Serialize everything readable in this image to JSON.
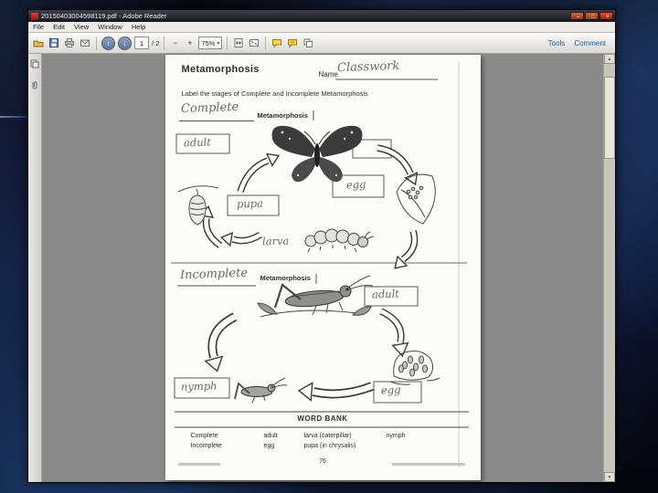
{
  "window": {
    "title": "20150403004598119.pdf - Adobe Reader",
    "menus": [
      "File",
      "Edit",
      "View",
      "Window",
      "Help"
    ],
    "toolbar": {
      "page_current": "1",
      "page_total_label": "/ 2",
      "zoom_value": "75%",
      "tools_label": "Tools",
      "comment_label": "Comment",
      "icon_names": [
        "open-icon",
        "save-icon",
        "print-icon",
        "email-icon",
        "previous-view-icon",
        "next-view-icon",
        "zoom-out-icon",
        "zoom-in-icon",
        "fit-width-icon",
        "fullscreen-icon",
        "sticky-note-icon",
        "highlight-icon",
        "share-icon"
      ]
    },
    "sidebar_icon_names": [
      "page-thumbnails-icon",
      "attachments-icon"
    ]
  },
  "icons": {
    "minimize_glyph": "–",
    "maximize_glyph": "□",
    "close_glyph": "×",
    "caret_glyph": "▾",
    "scroll_up_glyph": "▲",
    "scroll_down_glyph": "▼",
    "zoom_out_glyph": "−",
    "zoom_in_glyph": "+",
    "prev_glyph": "↑",
    "next_glyph": "↓"
  },
  "worksheet": {
    "title": "Metamorphosis",
    "name_label": "Name",
    "name_value": "Classwork",
    "instruction": "Label the stages of Complete and Incomplete Metamorphosis",
    "complete_section": {
      "handwritten_heading": "Complete",
      "heading_suffix": "Metamorphosis",
      "labels": {
        "adult": "adult",
        "egg": "egg",
        "pupa": "pupa",
        "larva": "larva"
      }
    },
    "incomplete_section": {
      "handwritten_heading": "Incomplete",
      "heading_suffix": "Metamorphosis",
      "labels": {
        "adult": "adult",
        "nymph": "nymph",
        "egg": "egg"
      }
    },
    "word_bank": {
      "title": "WORD BANK",
      "columns": [
        [
          "Complete",
          "Incomplete"
        ],
        [
          "adult",
          "egg"
        ],
        [
          "larva (caterpillar)",
          "pupa (in chrysalis)"
        ],
        [
          "nymph"
        ]
      ]
    },
    "footer": {
      "page_number": "76"
    }
  }
}
